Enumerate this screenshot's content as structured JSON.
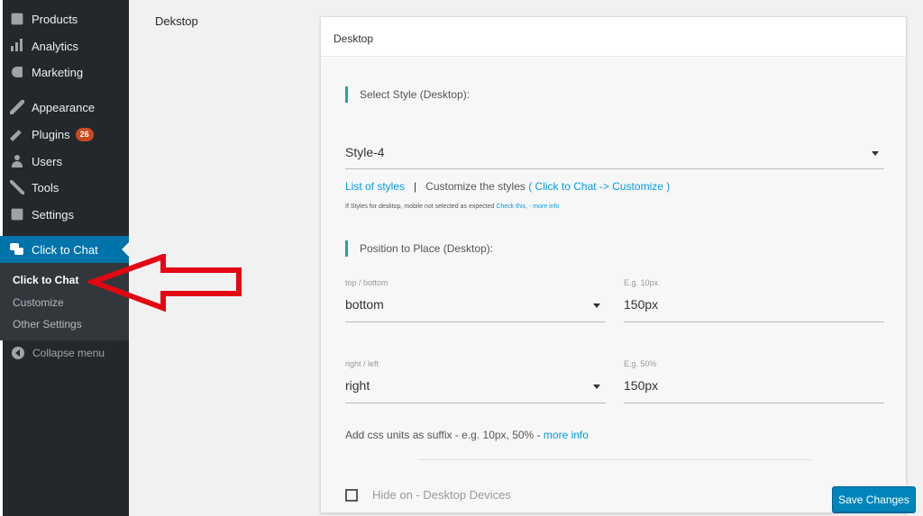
{
  "sidebar": {
    "items": [
      {
        "label": "Products",
        "icon": "cube-icon"
      },
      {
        "label": "Analytics",
        "icon": "bar-chart-icon"
      },
      {
        "label": "Marketing",
        "icon": "megaphone-icon"
      },
      {
        "label": "Appearance",
        "icon": "paintbrush-icon"
      },
      {
        "label": "Plugins",
        "icon": "plugin-icon",
        "badge": "26"
      },
      {
        "label": "Users",
        "icon": "user-icon"
      },
      {
        "label": "Tools",
        "icon": "wrench-icon"
      },
      {
        "label": "Settings",
        "icon": "settings-icon"
      },
      {
        "label": "Click to Chat",
        "icon": "chat-icon"
      }
    ],
    "submenu": [
      "Click to Chat",
      "Customize",
      "Other Settings"
    ],
    "collapse_label": "Collapse menu"
  },
  "main": {
    "section_label": "Dekstop",
    "card_title": "Desktop",
    "style_heading": "Select Style (Desktop):",
    "style_value": "Style-4",
    "list_styles_link": "List of styles",
    "separator": "|",
    "customize_text": "Customize the styles",
    "customize_link": "( Click to Chat -> Customize )",
    "note_text": "If Styles for desktop, mobile not selected as expected",
    "note_link": "Check this, - more info",
    "position_heading": "Position to Place (Desktop):",
    "vertical_label": "top / bottom",
    "vertical_value": "bottom",
    "vertical_offset_label": "E.g. 10px",
    "vertical_offset_value": "150px",
    "horizontal_label": "right / left",
    "horizontal_value": "right",
    "horizontal_offset_label": "E.g. 50%",
    "horizontal_offset_value": "150px",
    "units_note": "Add css units as suffix - e.g. 10px, 50% -",
    "units_link": "more info",
    "hide_label": "Hide on - Desktop Devices",
    "save_label": "Save Changes"
  },
  "colors": {
    "sidebar_bg": "#23282d",
    "active_bg": "#0073aa",
    "accent_bar": "#26a69a",
    "link": "#039be5",
    "badge": "#ca4a1f",
    "arrow": "#e30613",
    "button": "#0085ba"
  }
}
